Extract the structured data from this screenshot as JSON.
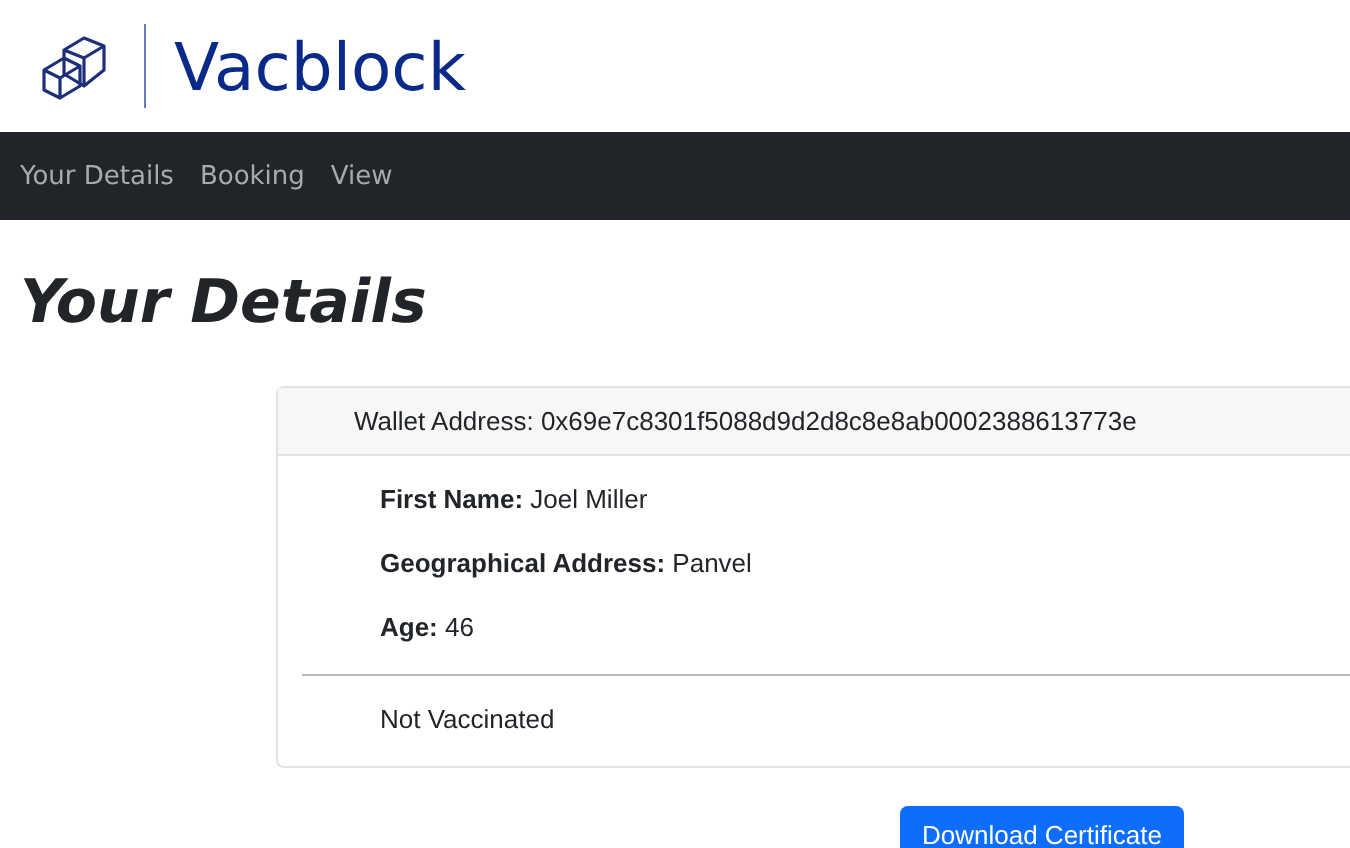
{
  "brand": {
    "name": "Vacblock"
  },
  "nav": {
    "items": [
      "Your Details",
      "Booking",
      "View"
    ]
  },
  "heading": "Your Details",
  "card": {
    "header": "Wallet Address: 0x69e7c8301f5088d9d2d8c8e8ab0002388613773e",
    "fields": [
      "**First Name:** Joel Miller",
      "**Geographical Address:** Panvel",
      "**Age:** 46"
    ],
    "status": "Not Vaccinated"
  },
  "button": "Download Certificate"
}
